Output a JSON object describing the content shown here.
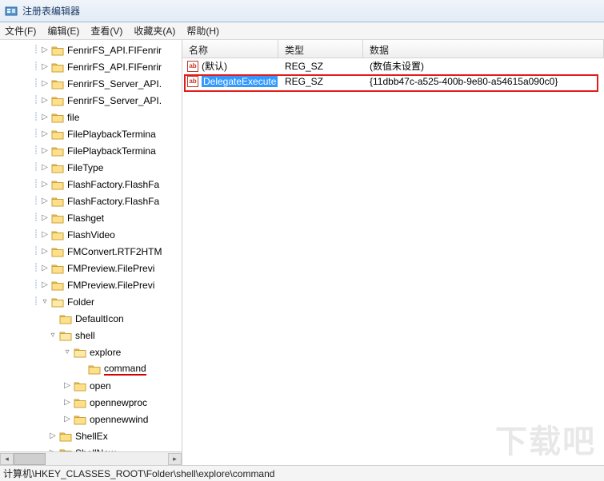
{
  "window": {
    "title": "注册表编辑器"
  },
  "menu": {
    "file": "文件(F)",
    "edit": "编辑(E)",
    "view": "查看(V)",
    "favorites": "收藏夹(A)",
    "help": "帮助(H)"
  },
  "tree": {
    "items": [
      {
        "indent": 42,
        "exp": "▷",
        "label": "FenrirFS_API.FIFenrir"
      },
      {
        "indent": 42,
        "exp": "▷",
        "label": "FenrirFS_API.FIFenrir"
      },
      {
        "indent": 42,
        "exp": "▷",
        "label": "FenrirFS_Server_API."
      },
      {
        "indent": 42,
        "exp": "▷",
        "label": "FenrirFS_Server_API."
      },
      {
        "indent": 42,
        "exp": "▷",
        "label": "file"
      },
      {
        "indent": 42,
        "exp": "▷",
        "label": "FilePlaybackTermina"
      },
      {
        "indent": 42,
        "exp": "▷",
        "label": "FilePlaybackTermina"
      },
      {
        "indent": 42,
        "exp": "▷",
        "label": "FileType"
      },
      {
        "indent": 42,
        "exp": "▷",
        "label": "FlashFactory.FlashFa"
      },
      {
        "indent": 42,
        "exp": "▷",
        "label": "FlashFactory.FlashFa"
      },
      {
        "indent": 42,
        "exp": "▷",
        "label": "Flashget"
      },
      {
        "indent": 42,
        "exp": "▷",
        "label": "FlashVideo"
      },
      {
        "indent": 42,
        "exp": "▷",
        "label": "FMConvert.RTF2HTM"
      },
      {
        "indent": 42,
        "exp": "▷",
        "label": "FMPreview.FilePrevi"
      },
      {
        "indent": 42,
        "exp": "▷",
        "label": "FMPreview.FilePrevi"
      },
      {
        "indent": 42,
        "exp": "▿",
        "label": "Folder"
      },
      {
        "indent": 60,
        "exp": "",
        "label": "DefaultIcon"
      },
      {
        "indent": 60,
        "exp": "▿",
        "label": "shell"
      },
      {
        "indent": 78,
        "exp": "▿",
        "label": "explore"
      },
      {
        "indent": 96,
        "exp": "",
        "label": "command",
        "red": true
      },
      {
        "indent": 78,
        "exp": "▷",
        "label": "open"
      },
      {
        "indent": 78,
        "exp": "▷",
        "label": "opennewproc"
      },
      {
        "indent": 78,
        "exp": "▷",
        "label": "opennewwind"
      },
      {
        "indent": 60,
        "exp": "▷",
        "label": "ShellEx"
      },
      {
        "indent": 60,
        "exp": "▷",
        "label": "ShellNew"
      }
    ]
  },
  "columns": {
    "name": "名称",
    "type": "类型",
    "data": "数据"
  },
  "rows": [
    {
      "icon": "ab",
      "name": "(默认)",
      "type": "REG_SZ",
      "data": "(数值未设置)",
      "selected": false
    },
    {
      "icon": "ab",
      "name": "DelegateExecute",
      "type": "REG_SZ",
      "data": "{11dbb47c-a525-400b-9e80-a54615a090c0}",
      "selected": true
    }
  ],
  "status": {
    "path": "计算机\\HKEY_CLASSES_ROOT\\Folder\\shell\\explore\\command"
  },
  "watermark": "下载吧"
}
